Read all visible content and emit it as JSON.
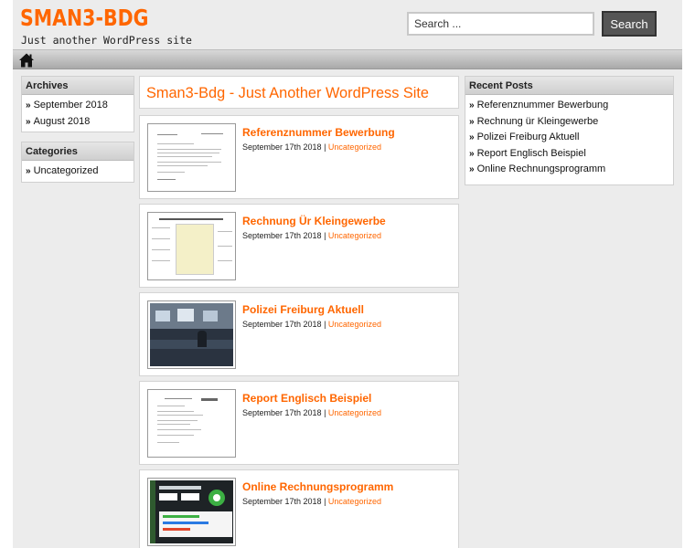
{
  "header": {
    "site_title": "SMAN3-BDG",
    "tagline": "Just another WordPress site",
    "search_placeholder": "Search ...",
    "search_button": "Search"
  },
  "nav": {
    "home_icon": "home-icon"
  },
  "sidebar_left": {
    "archives": {
      "title": "Archives",
      "items": [
        "September 2018",
        "August 2018"
      ]
    },
    "categories": {
      "title": "Categories",
      "items": [
        "Uncategorized"
      ]
    }
  },
  "sidebar_right": {
    "recent": {
      "title": "Recent Posts",
      "items": [
        "Referenznummer Bewerbung",
        "Rechnung ür Kleingewerbe",
        "Polizei Freiburg Aktuell",
        "Report Englisch Beispiel",
        "Online Rechnungsprogramm"
      ]
    }
  },
  "main": {
    "title": "Sman3-Bdg - Just Another WordPress Site",
    "posts": [
      {
        "title": "Referenznummer Bewerbung",
        "date": "September 17th 2018",
        "sep": " | ",
        "category": "Uncategorized"
      },
      {
        "title": "Rechnung Ür Kleingewerbe",
        "date": "September 17th 2018",
        "sep": " | ",
        "category": "Uncategorized"
      },
      {
        "title": "Polizei Freiburg Aktuell",
        "date": "September 17th 2018",
        "sep": " | ",
        "category": "Uncategorized"
      },
      {
        "title": "Report Englisch Beispiel",
        "date": "September 17th 2018",
        "sep": " | ",
        "category": "Uncategorized"
      },
      {
        "title": "Online Rechnungsprogramm",
        "date": "September 17th 2018",
        "sep": " | ",
        "category": "Uncategorized"
      }
    ]
  },
  "colors": {
    "accent": "#ff6600",
    "background": "#ececec",
    "button": "#555555"
  }
}
